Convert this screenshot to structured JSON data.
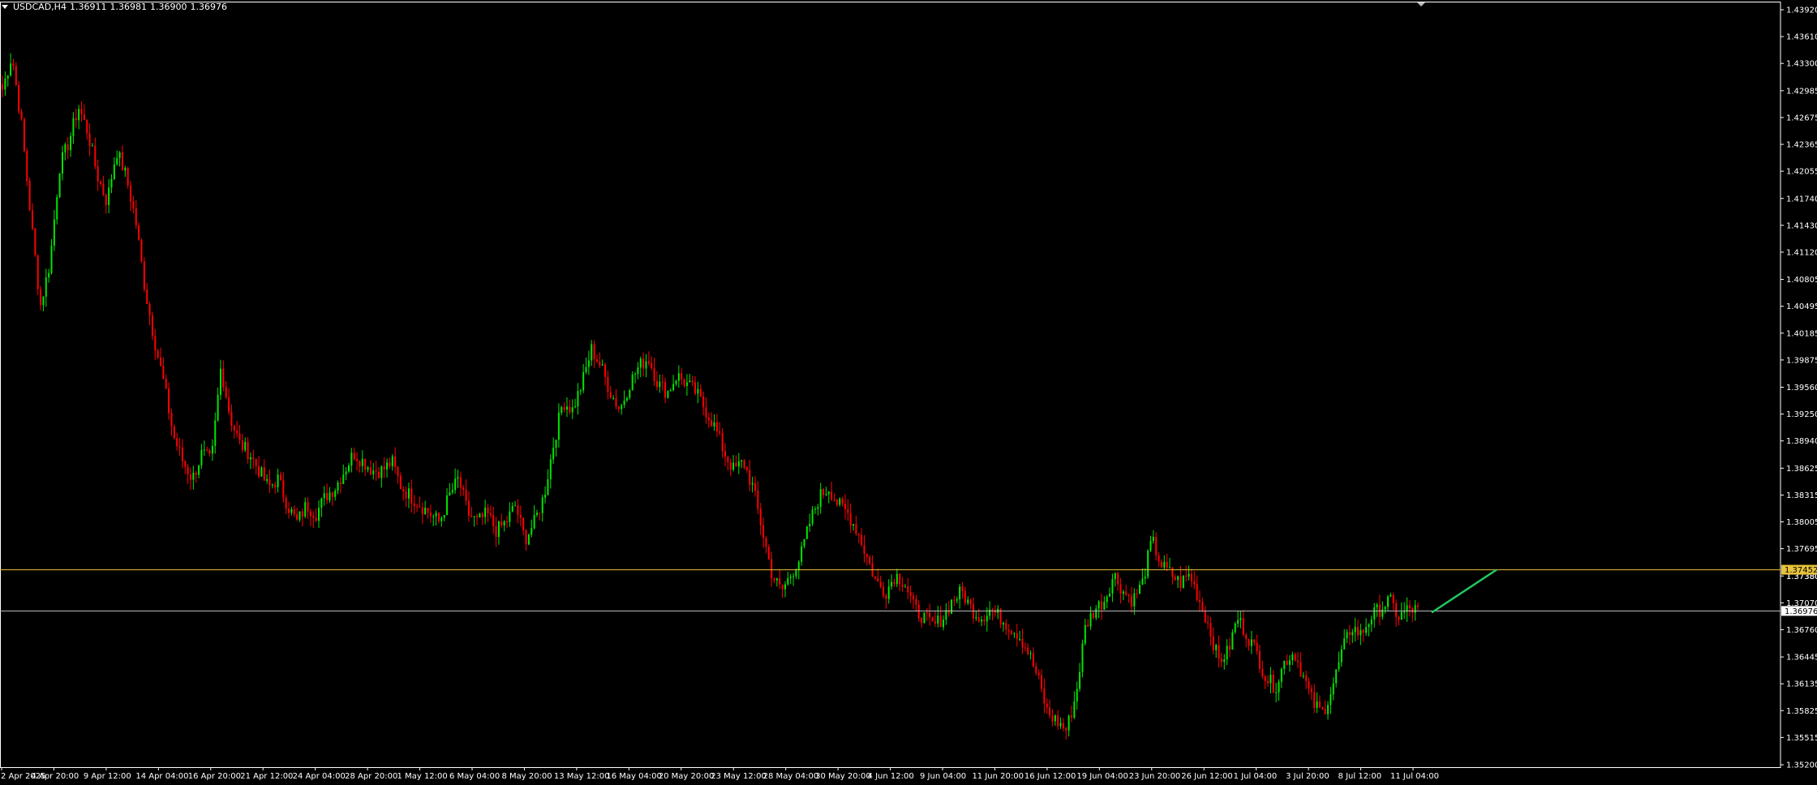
{
  "header": {
    "symbol": "USDCAD,H4",
    "open": "1.36911",
    "high": "1.36981",
    "low": "1.36900",
    "close": "1.36976"
  },
  "colors": {
    "background": "#000000",
    "bull_candle": "#00e600",
    "bear_candle": "#ff0000",
    "axis": "#ffffff",
    "resistance_line": "#e8c33a",
    "bid_line": "#c0c0c0",
    "trend_line": "#22c55e"
  },
  "price_axis": {
    "min": 1.352,
    "max": 1.4392,
    "labels": [
      "1.43920",
      "1.43610",
      "1.43300",
      "1.42985",
      "1.42675",
      "1.42365",
      "1.42055",
      "1.41740",
      "1.41430",
      "1.41120",
      "1.40805",
      "1.40495",
      "1.40185",
      "1.39875",
      "1.39560",
      "1.39250",
      "1.38940",
      "1.38625",
      "1.38315",
      "1.38005",
      "1.37695",
      "1.37380",
      "1.37070",
      "1.36760",
      "1.36445",
      "1.36135",
      "1.35825",
      "1.35515",
      "1.35200"
    ]
  },
  "time_axis": {
    "labels": [
      "2 Apr 2025",
      "4 Apr 20:00",
      "9 Apr 12:00",
      "14 Apr 04:00",
      "16 Apr 20:00",
      "21 Apr 12:00",
      "24 Apr 04:00",
      "28 Apr 20:00",
      "1 May 12:00",
      "6 May 04:00",
      "8 May 20:00",
      "13 May 12:00",
      "16 May 04:00",
      "20 May 20:00",
      "23 May 12:00",
      "28 May 04:00",
      "30 May 20:00",
      "4 Jun 12:00",
      "9 Jun 04:00",
      "11 Jun 20:00",
      "16 Jun 12:00",
      "19 Jun 04:00",
      "23 Jun 20:00",
      "26 Jun 12:00",
      "1 Jul 04:00",
      "3 Jul 20:00",
      "8 Jul 12:00",
      "11 Jul 04:00"
    ]
  },
  "levels": {
    "resistance": {
      "price": 1.37452,
      "label": "1.37452"
    },
    "current": {
      "price": 1.36976,
      "label": "1.36976"
    },
    "hidden_label": "1.37380"
  },
  "chart_data": {
    "type": "candlestick",
    "timeframe": "H4",
    "symbol": "USDCAD",
    "ylim": [
      1.352,
      1.4392
    ],
    "x_ticks": [
      "2 Apr 2025",
      "4 Apr 20:00",
      "9 Apr 12:00",
      "14 Apr 04:00",
      "16 Apr 20:00",
      "21 Apr 12:00",
      "24 Apr 04:00",
      "28 Apr 20:00",
      "1 May 12:00",
      "6 May 04:00",
      "8 May 20:00",
      "13 May 12:00",
      "16 May 04:00",
      "20 May 20:00",
      "23 May 12:00",
      "28 May 04:00",
      "30 May 20:00",
      "4 Jun 12:00",
      "9 Jun 04:00",
      "11 Jun 20:00",
      "16 Jun 12:00",
      "19 Jun 04:00",
      "23 Jun 20:00",
      "26 Jun 12:00",
      "1 Jul 04:00",
      "3 Jul 20:00",
      "8 Jul 12:00",
      "11 Jul 04:00"
    ],
    "close_path": [
      1.43,
      1.434,
      1.426,
      1.415,
      1.405,
      1.41,
      1.421,
      1.424,
      1.428,
      1.425,
      1.42,
      1.417,
      1.423,
      1.42,
      1.415,
      1.407,
      1.401,
      1.396,
      1.39,
      1.387,
      1.385,
      1.388,
      1.387,
      1.398,
      1.392,
      1.389,
      1.388,
      1.386,
      1.384,
      1.385,
      1.382,
      1.38,
      1.382,
      1.381,
      1.383,
      1.384,
      1.386,
      1.388,
      1.387,
      1.386,
      1.386,
      1.387,
      1.384,
      1.383,
      1.382,
      1.381,
      1.38,
      1.383,
      1.385,
      1.381,
      1.38,
      1.381,
      1.379,
      1.38,
      1.382,
      1.378,
      1.38,
      1.383,
      1.389,
      1.394,
      1.393,
      1.396,
      1.4,
      1.398,
      1.395,
      1.393,
      1.396,
      1.398,
      1.399,
      1.396,
      1.395,
      1.397,
      1.396,
      1.395,
      1.393,
      1.391,
      1.388,
      1.386,
      1.387,
      1.384,
      1.379,
      1.374,
      1.372,
      1.374,
      1.376,
      1.38,
      1.383,
      1.384,
      1.382,
      1.381,
      1.379,
      1.376,
      1.373,
      1.372,
      1.374,
      1.373,
      1.37,
      1.369,
      1.368,
      1.369,
      1.371,
      1.372,
      1.37,
      1.369,
      1.37,
      1.369,
      1.368,
      1.367,
      1.365,
      1.362,
      1.358,
      1.357,
      1.356,
      1.36,
      1.368,
      1.37,
      1.371,
      1.374,
      1.372,
      1.371,
      1.373,
      1.378,
      1.375,
      1.374,
      1.373,
      1.374,
      1.371,
      1.368,
      1.364,
      1.365,
      1.369,
      1.367,
      1.365,
      1.362,
      1.361,
      1.364,
      1.365,
      1.362,
      1.359,
      1.358,
      1.361,
      1.365,
      1.368,
      1.367,
      1.369,
      1.37,
      1.371,
      1.369,
      1.37,
      1.3698
    ]
  }
}
